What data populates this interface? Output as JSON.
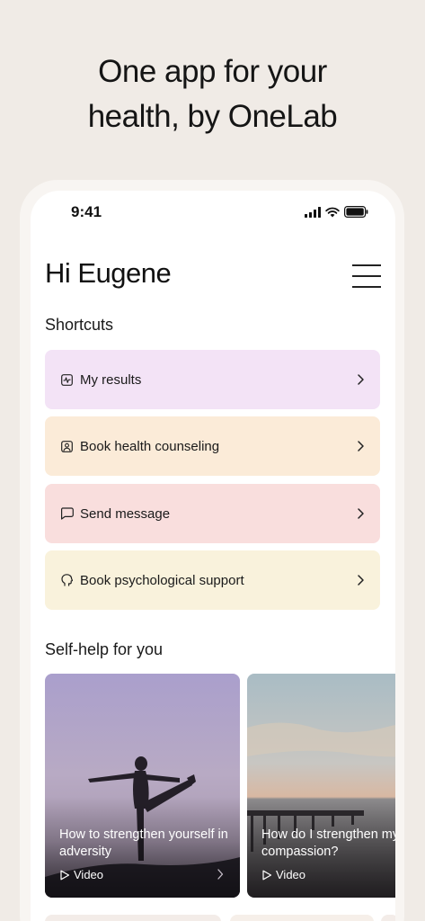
{
  "headline": {
    "line1": "One app for your",
    "line2": "health, by OneLab"
  },
  "status_bar": {
    "time": "9:41",
    "icons": [
      "signal-icon",
      "wifi-icon",
      "battery-icon"
    ]
  },
  "header": {
    "greeting": "Hi Eugene",
    "menu_icon": "hamburger-menu-icon"
  },
  "shortcuts": {
    "title": "Shortcuts",
    "items": [
      {
        "label": "My results",
        "icon": "health-chart-icon",
        "color": "#f3e3f6"
      },
      {
        "label": "Book health counseling",
        "icon": "person-portrait-icon",
        "color": "#fbebd8"
      },
      {
        "label": "Send message",
        "icon": "chat-bubble-icon",
        "color": "#f9dedd"
      },
      {
        "label": "Book psychological support",
        "icon": "head-profile-icon",
        "color": "#f9f2dc"
      }
    ]
  },
  "self_help": {
    "title": "Self-help for you",
    "cards": [
      {
        "title": "How to strengthen yourself in adversity",
        "type": "Video"
      },
      {
        "title": "How do I strengthen my self-compassion?",
        "type": "Video"
      }
    ]
  },
  "colors": {
    "background": "#f0ebe6",
    "screen": "#ffffff",
    "text": "#1c1c1c"
  }
}
